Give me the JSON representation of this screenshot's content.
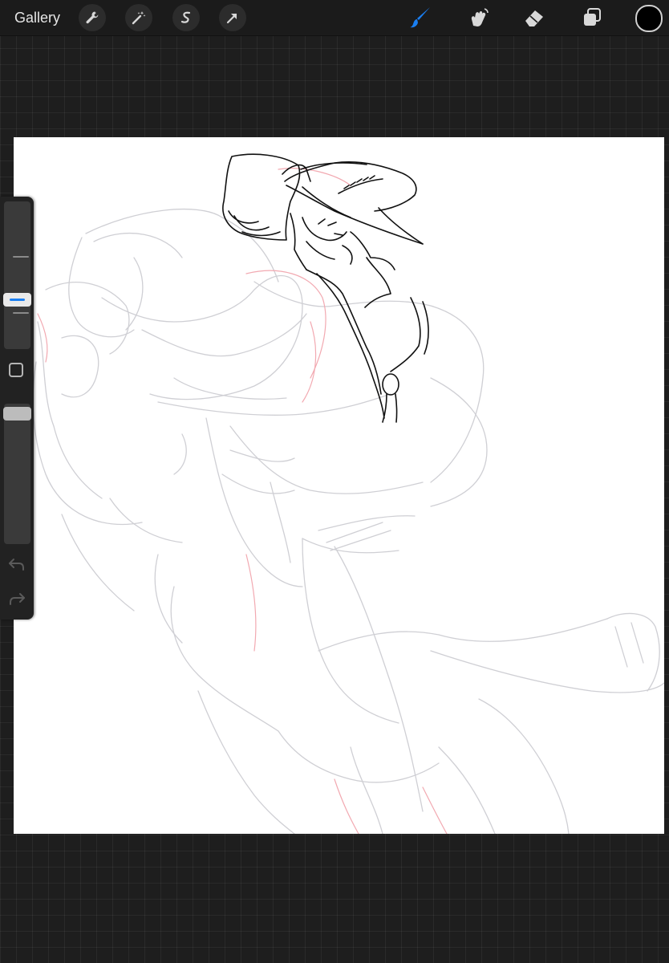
{
  "toolbar": {
    "gallery_label": "Gallery",
    "left_tools": [
      {
        "name": "actions",
        "icon": "wrench-icon"
      },
      {
        "name": "adjustments",
        "icon": "magic-wand-icon"
      },
      {
        "name": "selection",
        "icon": "selection-s-icon"
      },
      {
        "name": "transform",
        "icon": "arrow-cursor-icon"
      }
    ],
    "right_tools": [
      {
        "name": "brush",
        "icon": "brush-icon",
        "active": true
      },
      {
        "name": "smudge",
        "icon": "smudge-finger-icon",
        "active": false
      },
      {
        "name": "eraser",
        "icon": "eraser-icon",
        "active": false
      },
      {
        "name": "layers",
        "icon": "layers-icon",
        "active": false
      }
    ],
    "current_color": "#000000",
    "accent_color": "#1a7ff2"
  },
  "sidebar": {
    "brush_size_slider": {
      "icon": "brush-size-slider"
    },
    "modify_button": {
      "icon": "square-icon"
    },
    "opacity_slider": {
      "icon": "opacity-slider"
    },
    "undo": {
      "icon": "undo-arrow-icon"
    },
    "redo": {
      "icon": "redo-arrow-icon"
    }
  },
  "canvas": {
    "background": "#ffffff",
    "sketch_color": "#c8c8cc",
    "construction_color": "#f0a0a8",
    "lineart_color": "#000000"
  }
}
